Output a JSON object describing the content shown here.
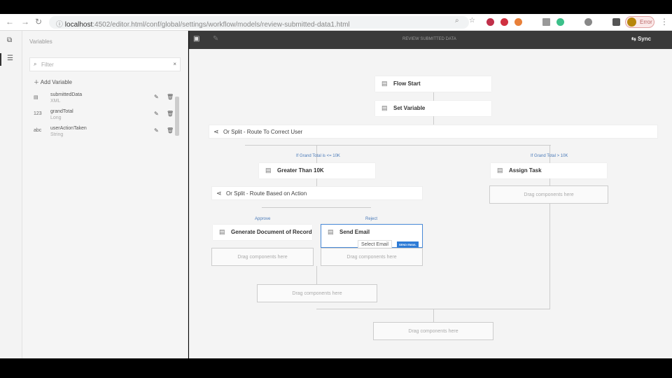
{
  "browser": {
    "url_host": "localhost",
    "url_path": ":4502/editor.html/conf/global/settings/workflow/models/review-submitted-data1.html",
    "profile_label": "Error"
  },
  "sidebar": {
    "title": "Variables",
    "filter_placeholder": "Filter",
    "add_label": "Add Variable",
    "variables": [
      {
        "name": "submittedData",
        "type": "XML",
        "icon": "XML"
      },
      {
        "name": "grandTotal",
        "type": "Long",
        "icon": "123"
      },
      {
        "name": "userActionTaken",
        "type": "String",
        "icon": "abc"
      }
    ]
  },
  "toolbar": {
    "title": "REVIEW SUBMITTED DATA",
    "sync_label": "Sync"
  },
  "flow": {
    "flow_start": "Flow Start",
    "set_variable": "Set Variable",
    "split1": "Or Split - Route To Correct User",
    "cond_left": "If Grand Total is <= 10K",
    "cond_right": "If Grand Total > 10K",
    "greater": "Greater Than 10K",
    "assign": "Assign Task",
    "split2": "Or Split - Route Based on Action",
    "approve": "Approve",
    "reject": "Reject",
    "gen_doc": "Generate Document of Record",
    "send_email": "Send Email",
    "tooltip": "Select Email",
    "badge": "SEND EMAIL",
    "drop": "Drag components here"
  }
}
